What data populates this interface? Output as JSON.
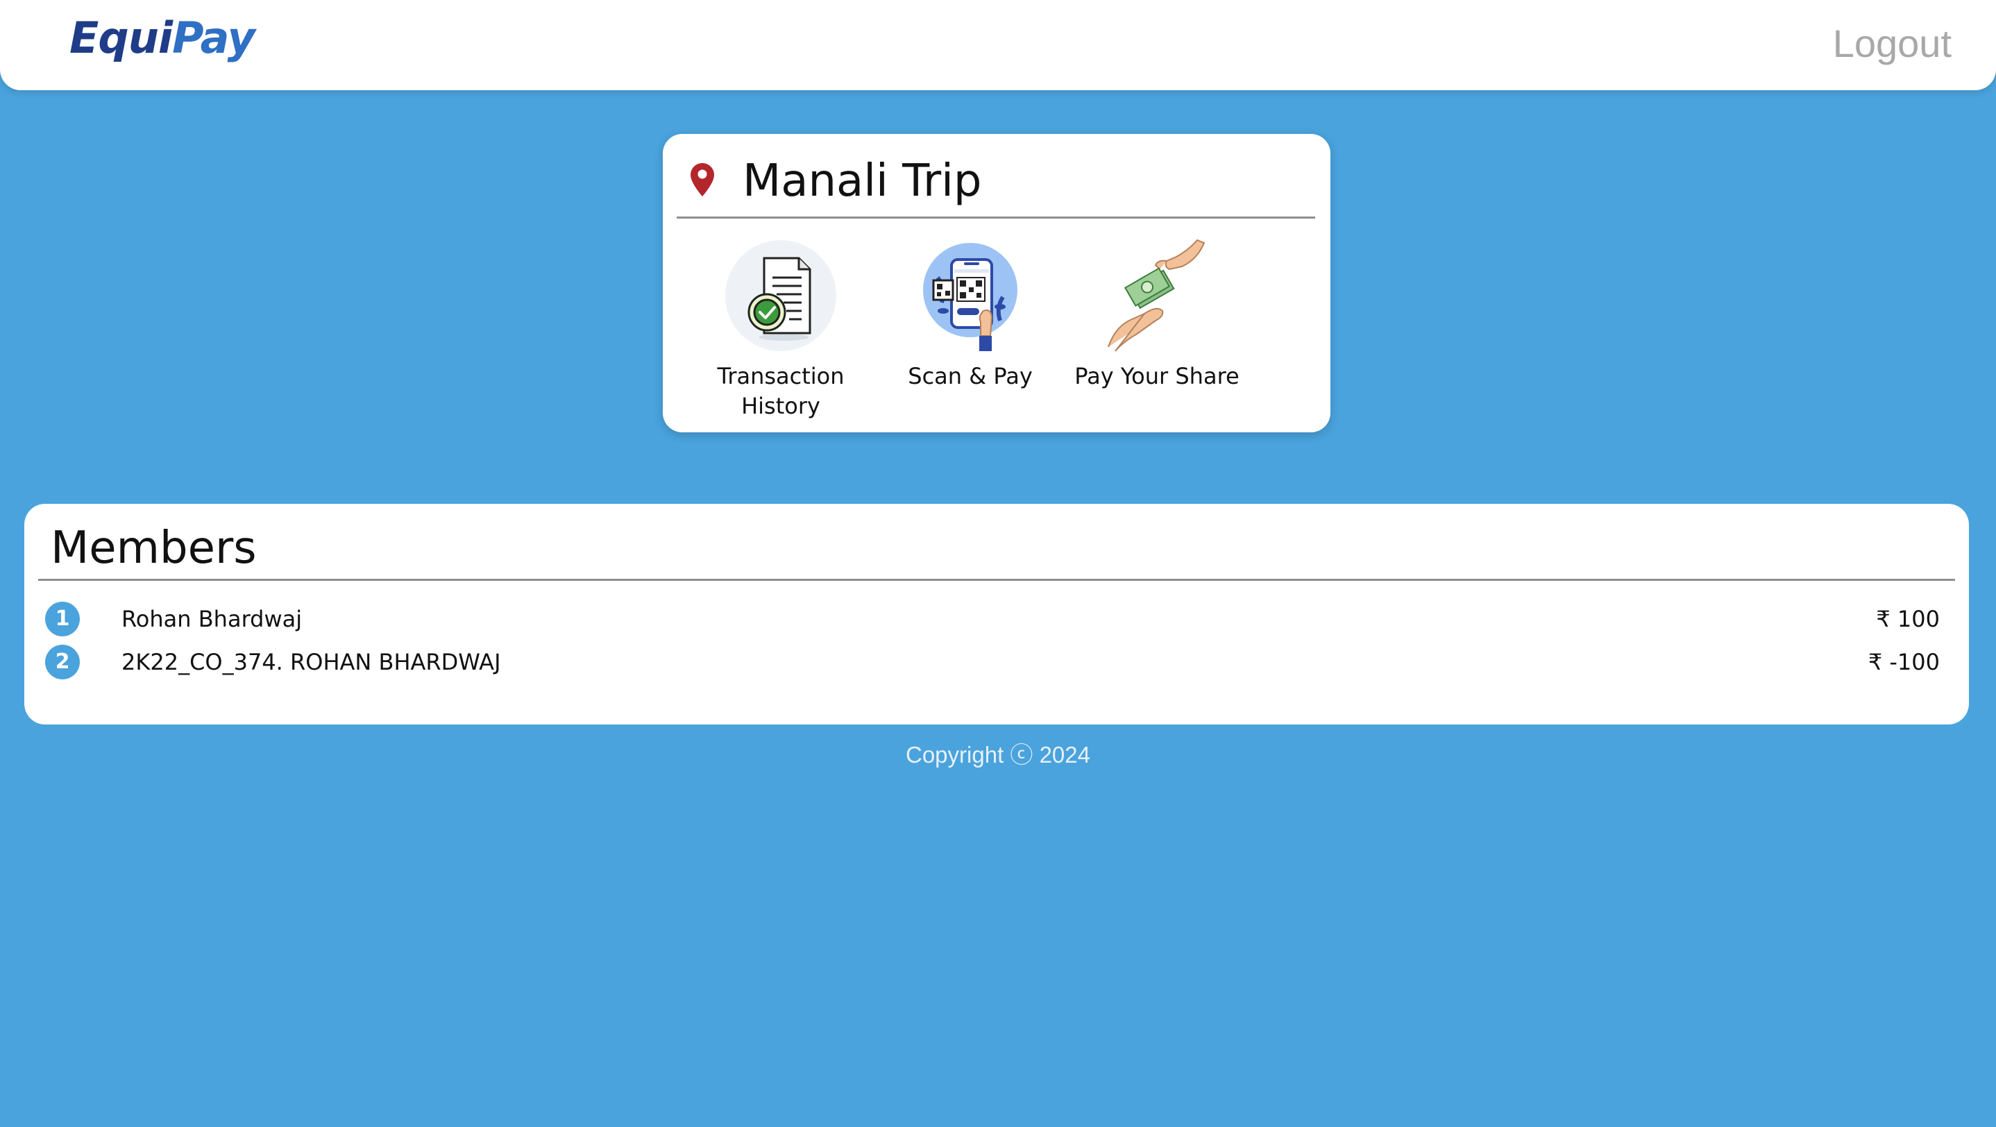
{
  "navbar": {
    "brand_part1": "Equi",
    "brand_part2": "Pay",
    "logout_label": "Logout"
  },
  "trip": {
    "title": "Manali Trip",
    "pin_icon": "location-pin-icon",
    "actions": [
      {
        "label": "Transaction History",
        "icon": "document-check-icon"
      },
      {
        "label": "Scan & Pay",
        "icon": "qr-phone-icon"
      },
      {
        "label": "Pay Your Share",
        "icon": "money-handover-icon"
      }
    ]
  },
  "members": {
    "title": "Members",
    "items": [
      {
        "number": "1",
        "name": "Rohan Bhardwaj",
        "amount": "₹ 100"
      },
      {
        "number": "2",
        "name": "2K22_CO_374. ROHAN BHARDWAJ",
        "amount": "₹ -100"
      }
    ]
  },
  "footer": {
    "copyright": "Copyright ⓒ 2024"
  },
  "colors": {
    "background": "#4aa3dd",
    "brand_dark": "#1f3c88",
    "brand_light": "#2f6fc4",
    "pin": "#b3262b",
    "number_badge": "#4aa3dd"
  }
}
